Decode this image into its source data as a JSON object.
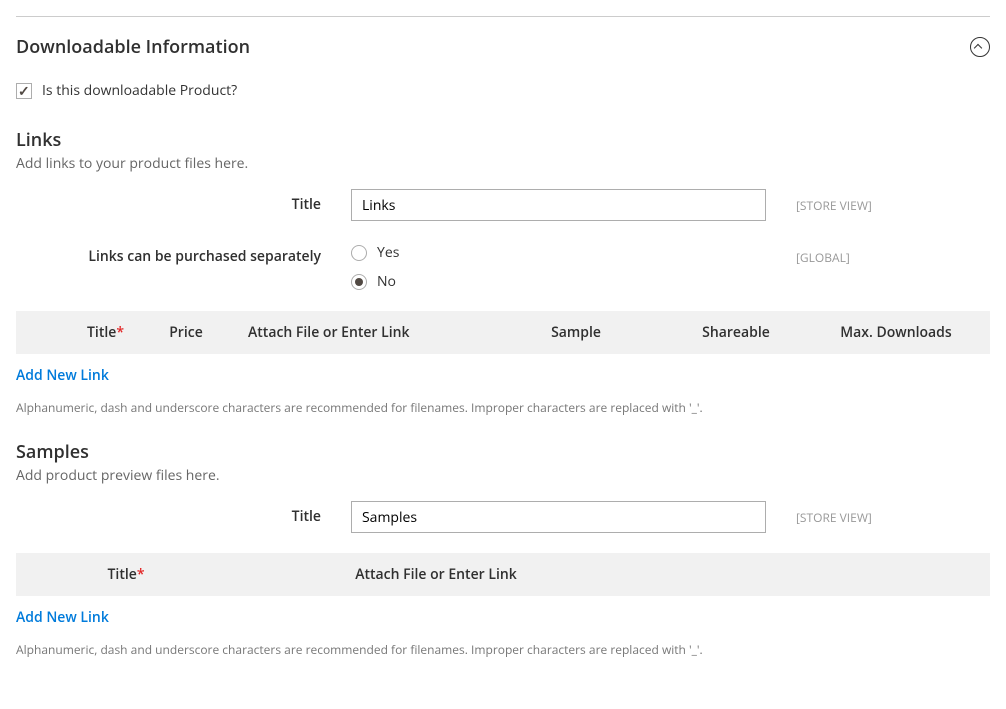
{
  "section": {
    "title": "Downloadable Information"
  },
  "checkbox": {
    "label": "Is this downloadable Product?",
    "checked": true
  },
  "links": {
    "heading": "Links",
    "desc": "Add links to your product files here.",
    "title_label": "Title",
    "title_value": "Links",
    "title_scope": "[STORE VIEW]",
    "purchase_label": "Links can be purchased separately",
    "purchase_yes": "Yes",
    "purchase_no": "No",
    "purchase_scope": "[GLOBAL]",
    "grid": {
      "col_title": "Title",
      "col_price": "Price",
      "col_attach": "Attach File or Enter Link",
      "col_sample": "Sample",
      "col_share": "Shareable",
      "col_max": "Max. Downloads"
    },
    "add_new": "Add New Link",
    "note": "Alphanumeric, dash and underscore characters are recommended for filenames. Improper characters are replaced with '_'."
  },
  "samples": {
    "heading": "Samples",
    "desc": "Add product preview files here.",
    "title_label": "Title",
    "title_value": "Samples",
    "title_scope": "[STORE VIEW]",
    "grid": {
      "col_title": "Title",
      "col_attach": "Attach File or Enter Link"
    },
    "add_new": "Add New Link",
    "note": "Alphanumeric, dash and underscore characters are recommended for filenames. Improper characters are replaced with '_'."
  }
}
